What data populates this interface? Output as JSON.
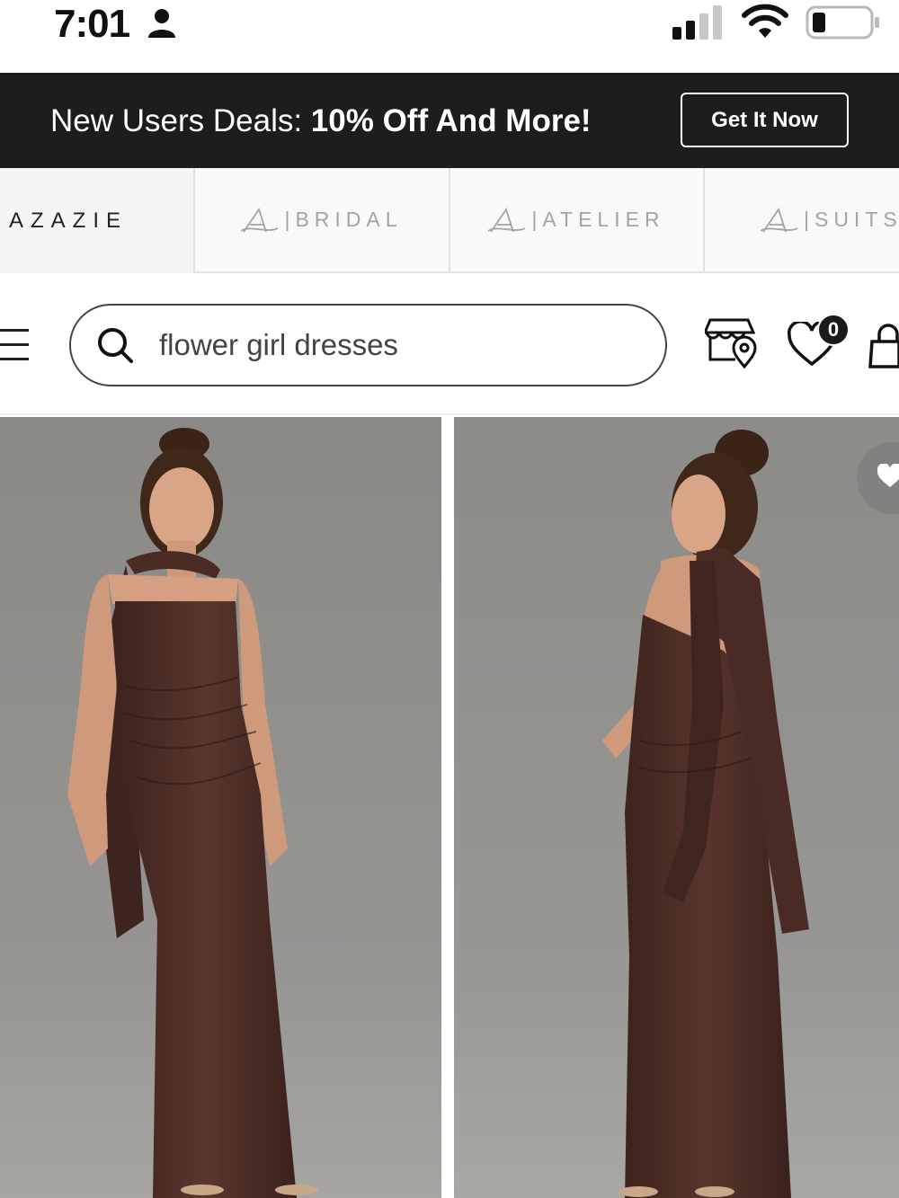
{
  "status_bar": {
    "time": "7:01",
    "icons": [
      "person-icon",
      "cellular-signal-icon",
      "wifi-icon",
      "battery-icon"
    ]
  },
  "promo": {
    "text_regular": "New Users Deals: ",
    "text_bold": "10% Off And More!",
    "button_label": "Get It Now",
    "background": "#1d1d1d"
  },
  "brand_tabs": [
    {
      "label": "AZAZIE",
      "active": true
    },
    {
      "label": "BRIDAL",
      "active": false
    },
    {
      "label": "ATELIER",
      "active": false
    },
    {
      "label": "SUITS",
      "active": false
    }
  ],
  "search": {
    "query": "flower girl dresses"
  },
  "header_icons": {
    "store": "store-location-icon",
    "wishlist": "heart-icon",
    "wishlist_count": "0",
    "bag": "shopping-bag-icon"
  },
  "products": [
    {
      "image": "model-front-view-dress",
      "color": "#4a2a24"
    },
    {
      "image": "model-back-view-dress",
      "color": "#4a2a24"
    }
  ]
}
